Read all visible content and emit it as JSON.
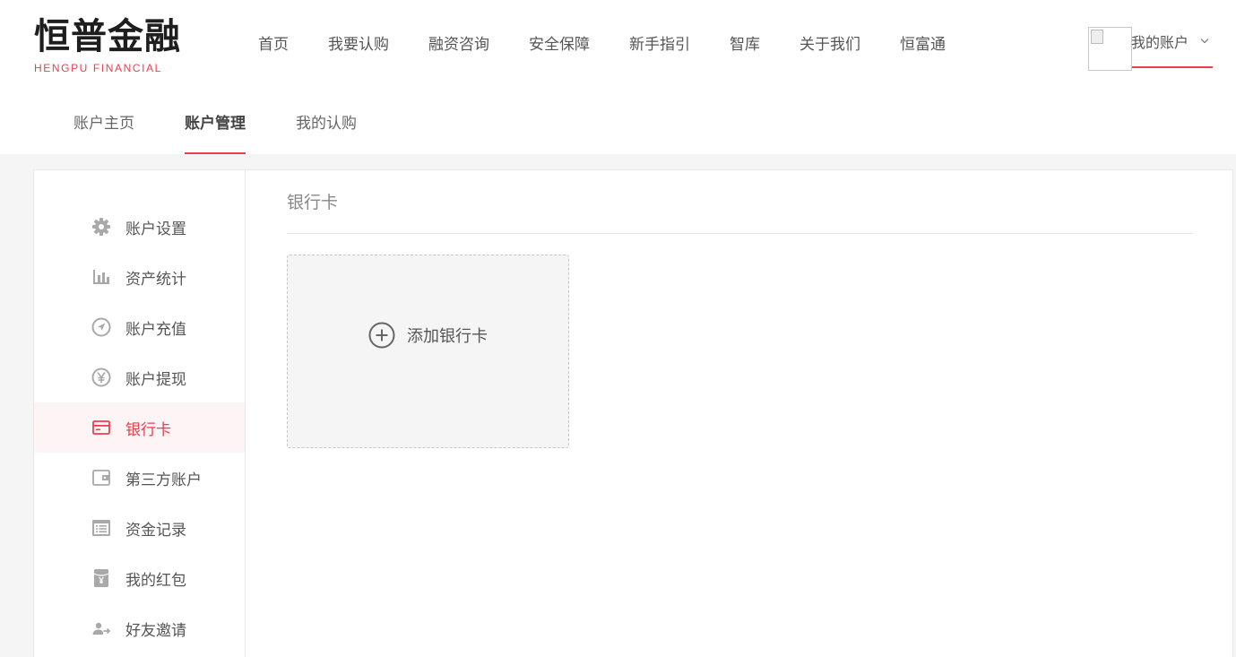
{
  "brand": {
    "name_cn": "恒普金融",
    "name_en": "HENGPU FINANCIAL",
    "accent_color": "#e9404f"
  },
  "nav": {
    "items": [
      {
        "label": "首页"
      },
      {
        "label": "我要认购"
      },
      {
        "label": "融资咨询"
      },
      {
        "label": "安全保障"
      },
      {
        "label": "新手指引"
      },
      {
        "label": "智库"
      },
      {
        "label": "关于我们"
      },
      {
        "label": "恒富通"
      }
    ]
  },
  "account": {
    "label": "我的账户",
    "icon": "chevron-down-icon"
  },
  "subnav": {
    "items": [
      {
        "label": "账户主页"
      },
      {
        "label": "账户管理",
        "active": true
      },
      {
        "label": "我的认购"
      }
    ]
  },
  "sidebar": {
    "items": [
      {
        "label": "账户设置",
        "icon": "gear-icon"
      },
      {
        "label": "资产统计",
        "icon": "bar-chart-icon"
      },
      {
        "label": "账户充值",
        "icon": "compass-send-icon"
      },
      {
        "label": "账户提现",
        "icon": "yen-circle-icon"
      },
      {
        "label": "银行卡",
        "icon": "credit-card-icon",
        "active": true
      },
      {
        "label": "第三方账户",
        "icon": "wallet-icon"
      },
      {
        "label": "资金记录",
        "icon": "list-icon"
      },
      {
        "label": "我的红包",
        "icon": "red-envelope-icon"
      },
      {
        "label": "好友邀请",
        "icon": "invite-user-icon"
      }
    ]
  },
  "content": {
    "title": "银行卡",
    "add_card_label": "添加银行卡",
    "add_icon": "plus-circle-icon"
  }
}
